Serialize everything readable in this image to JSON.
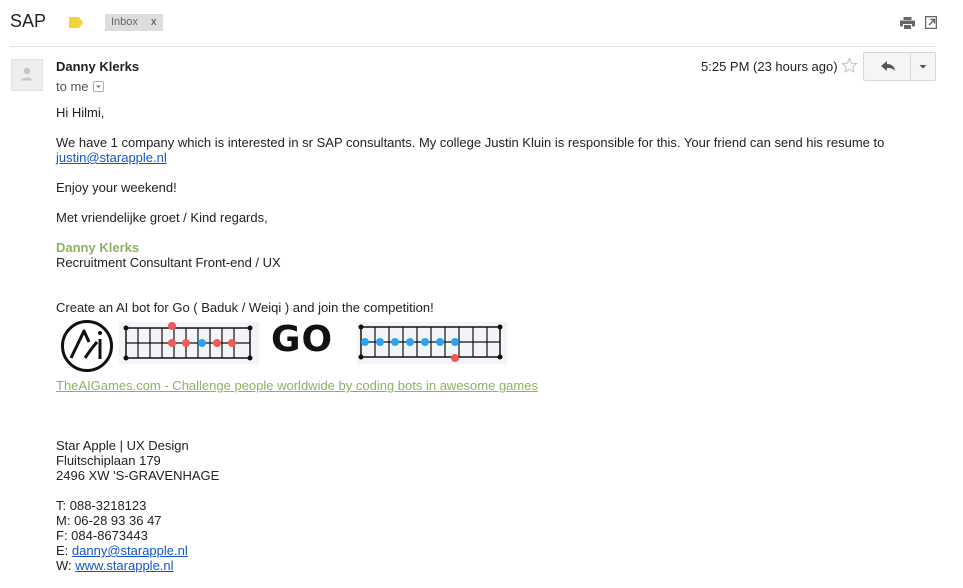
{
  "header": {
    "subject": "SAP",
    "label_chip": "Inbox",
    "label_remove": "x"
  },
  "message": {
    "sender": "Danny Klerks",
    "recipient": "to me",
    "time": "5:25 PM (23 hours ago)",
    "body": {
      "greeting": "Hi Hilmi,",
      "para1": "We have 1 company which is interested in sr SAP consultants. My college Justin Kluin is responsible for this. Your friend can send his resume to",
      "para1_link": "justin@starapple.nl",
      "para2": "Enjoy your weekend!",
      "closing": "Met vriendelijke groet / Kind regards,",
      "signature_name": "Danny Klerks",
      "signature_title": "Recruitment Consultant Front-end / UX",
      "promo": "Create an AI bot for Go ( Baduk / Weiqi ) and join the competition!",
      "banner_text": "GO",
      "promo_link": "TheAIGames.com - Challenge people worldwide by coding bots in awesome games",
      "company": "Star Apple | UX Design",
      "address1": "Fluitschiplaan 179",
      "address2": "2496 XW 'S-GRAVENHAGE",
      "contacts": [
        {
          "prefix": "T: ",
          "value": "088-3218123"
        },
        {
          "prefix": "M: ",
          "value": "06-28 93 36 47"
        },
        {
          "prefix": "F: ",
          "value": "084-8673443"
        },
        {
          "prefix": "E: ",
          "value": "danny@starapple.nl"
        },
        {
          "prefix": "W: ",
          "value": "www.starapple.nl"
        }
      ]
    }
  },
  "colors": {
    "link": "#1155cc",
    "signature_green": "#8fb163",
    "label_yellow": "#f5d238",
    "stone_red": "#f05a5a",
    "stone_blue": "#2aa4f0"
  },
  "icons": [
    "label-icon",
    "print-icon",
    "new-window-icon",
    "avatar-icon",
    "star-icon",
    "reply-icon",
    "more-chevron-icon"
  ]
}
